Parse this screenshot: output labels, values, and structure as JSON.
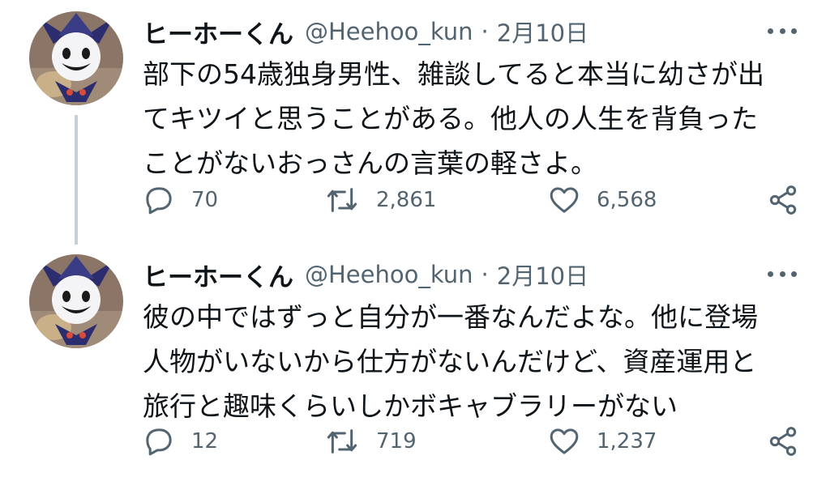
{
  "tweets": [
    {
      "name": "ヒーホーくん",
      "handle": "@Heehoo_kun",
      "separator": "·",
      "date": "2月10日",
      "lines": [
        "部下の54歳独身男性、雑談してると本当に幼さが出",
        "てキツイと思うことがある。他人の人生を背負った",
        "ことがないおっさんの言葉の軽さよ。"
      ],
      "replies": "70",
      "retweets": "2,861",
      "likes": "6,568"
    },
    {
      "name": "ヒーホーくん",
      "handle": "@Heehoo_kun",
      "separator": "·",
      "date": "2月10日",
      "lines": [
        "彼の中ではずっと自分が一番なんだよな。他に登場",
        "人物がいないから仕方がないんだけど、資産運用と",
        "旅行と趣味くらいしかボキャブラリーがない"
      ],
      "replies": "12",
      "retweets": "719",
      "likes": "1,237"
    }
  ],
  "icons": {
    "avatar": "jack-frost-avatar",
    "more": "more-icon",
    "reply": "reply-icon",
    "retweet": "retweet-icon",
    "like": "like-icon",
    "share": "share-icon"
  },
  "colors": {
    "text": "#0f1419",
    "secondary": "#536471",
    "thread_line": "#c4cfd6"
  }
}
